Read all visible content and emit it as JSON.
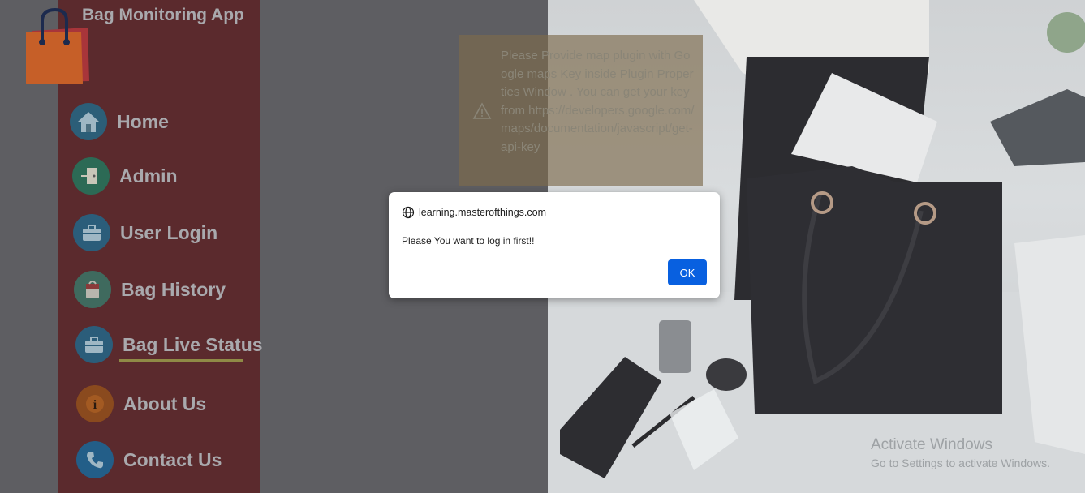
{
  "app": {
    "title": "Bag Monitoring App",
    "logo_icon": "shopping-bag-icon"
  },
  "sidebar": {
    "items": [
      {
        "label": "Home",
        "icon": "home-icon",
        "active": false
      },
      {
        "label": "Admin",
        "icon": "door-icon",
        "active": false
      },
      {
        "label": "User Login",
        "icon": "briefcase-icon",
        "active": false
      },
      {
        "label": "Bag History",
        "icon": "bag-icon",
        "active": false
      },
      {
        "label": "Bag Live Status",
        "icon": "briefcase-icon",
        "active": true
      },
      {
        "label": "About Us",
        "icon": "info-icon",
        "active": false
      },
      {
        "label": "Contact Us",
        "icon": "phone-icon",
        "active": false
      }
    ],
    "accent_underline_color": "#8f8a46"
  },
  "map_notice": {
    "icon": "warning-icon",
    "text": "Please Provide map plugin with Google maps Key inside Plugin Properties Window . You can get your key from https://developers.google.com/maps/documentation/javascript/get-api-key"
  },
  "dialog": {
    "origin": "learning.masterofthings.com",
    "origin_icon": "globe-icon",
    "message": "Please You want to log in first!!",
    "ok_label": "OK",
    "button_color": "#0860e0"
  },
  "watermark": {
    "title": "Activate Windows",
    "subtitle": "Go to Settings to activate Windows."
  }
}
